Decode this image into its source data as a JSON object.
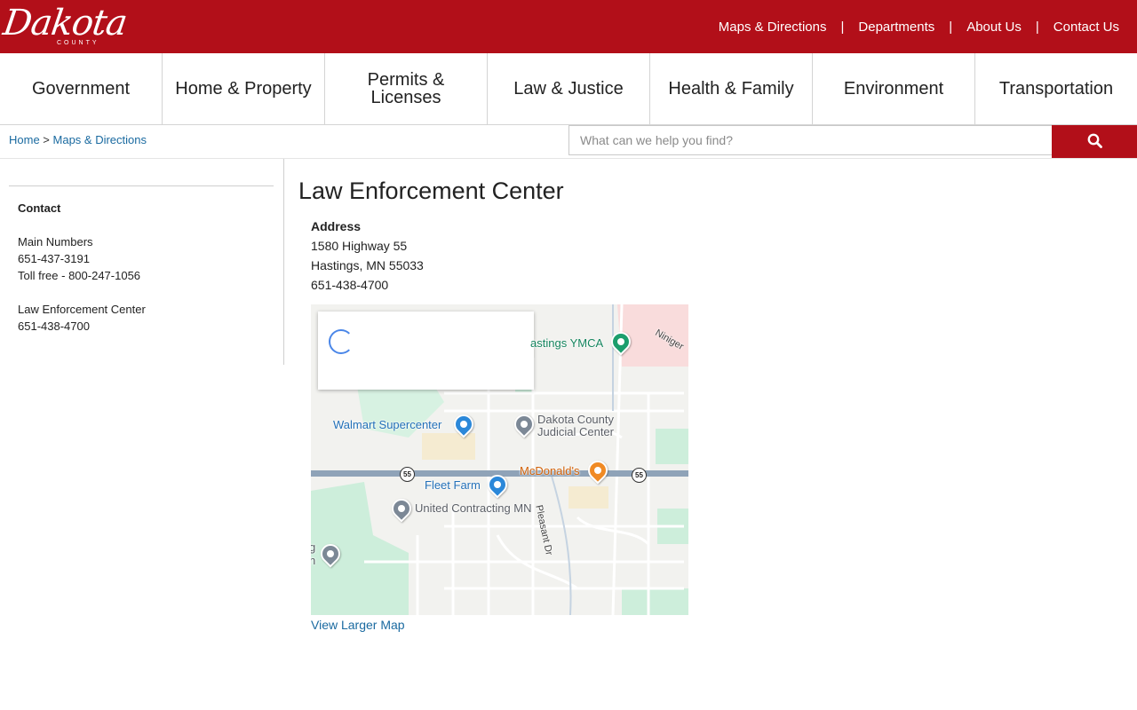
{
  "header": {
    "logo_script": "Dakota",
    "logo_sub": "COUNTY",
    "links": [
      {
        "label": "Maps & Directions"
      },
      {
        "label": "Departments"
      },
      {
        "label": "About Us"
      },
      {
        "label": "Contact Us"
      }
    ],
    "separator": "|"
  },
  "nav": [
    {
      "label": "Government"
    },
    {
      "label": "Home & Property"
    },
    {
      "label": "Permits & Licenses"
    },
    {
      "label": "Law & Justice"
    },
    {
      "label": "Health & Family"
    },
    {
      "label": "Environment"
    },
    {
      "label": "Transportation"
    }
  ],
  "breadcrumb": {
    "home": "Home",
    "separator": " > ",
    "current": "Maps & Directions"
  },
  "search": {
    "placeholder": "What can we help you find?",
    "value": ""
  },
  "sidebar": {
    "heading": "Contact",
    "main_title": "Main Numbers",
    "main_phone": "651-437-3191",
    "toll_free": "Toll free - 800-247-1056",
    "lec_title": "Law Enforcement Center",
    "lec_phone": "651-438-4700"
  },
  "content": {
    "title": "Law Enforcement Center",
    "address_label": "Address",
    "street": "1580 Highway 55",
    "city": "Hastings, MN 55033",
    "phone": "651-438-4700",
    "map_link": "View Larger Map"
  },
  "map": {
    "labels": {
      "ymca": "astings YMCA",
      "niniger": "Niniger",
      "walmart": "Walmart Supercenter",
      "judicial_1": "Dakota County",
      "judicial_2": "Judicial Center",
      "mcdonalds": "McDonald's",
      "fleet_farm": "Fleet Farm",
      "united": "United Contracting MN",
      "pleasant": "Pleasant Dr",
      "edge_1": "g",
      "edge_2": "n",
      "hwy_left": "55",
      "hwy_right": "55"
    },
    "colors": {
      "park": "#cdeedb",
      "road": "#ffffff",
      "highway": "#8fa3b8",
      "residential": "#f9dcdc",
      "commercial": "#f5ebd1"
    }
  },
  "colors": {
    "brand_red": "#b20f19",
    "link_blue": "#1a6aa0"
  }
}
